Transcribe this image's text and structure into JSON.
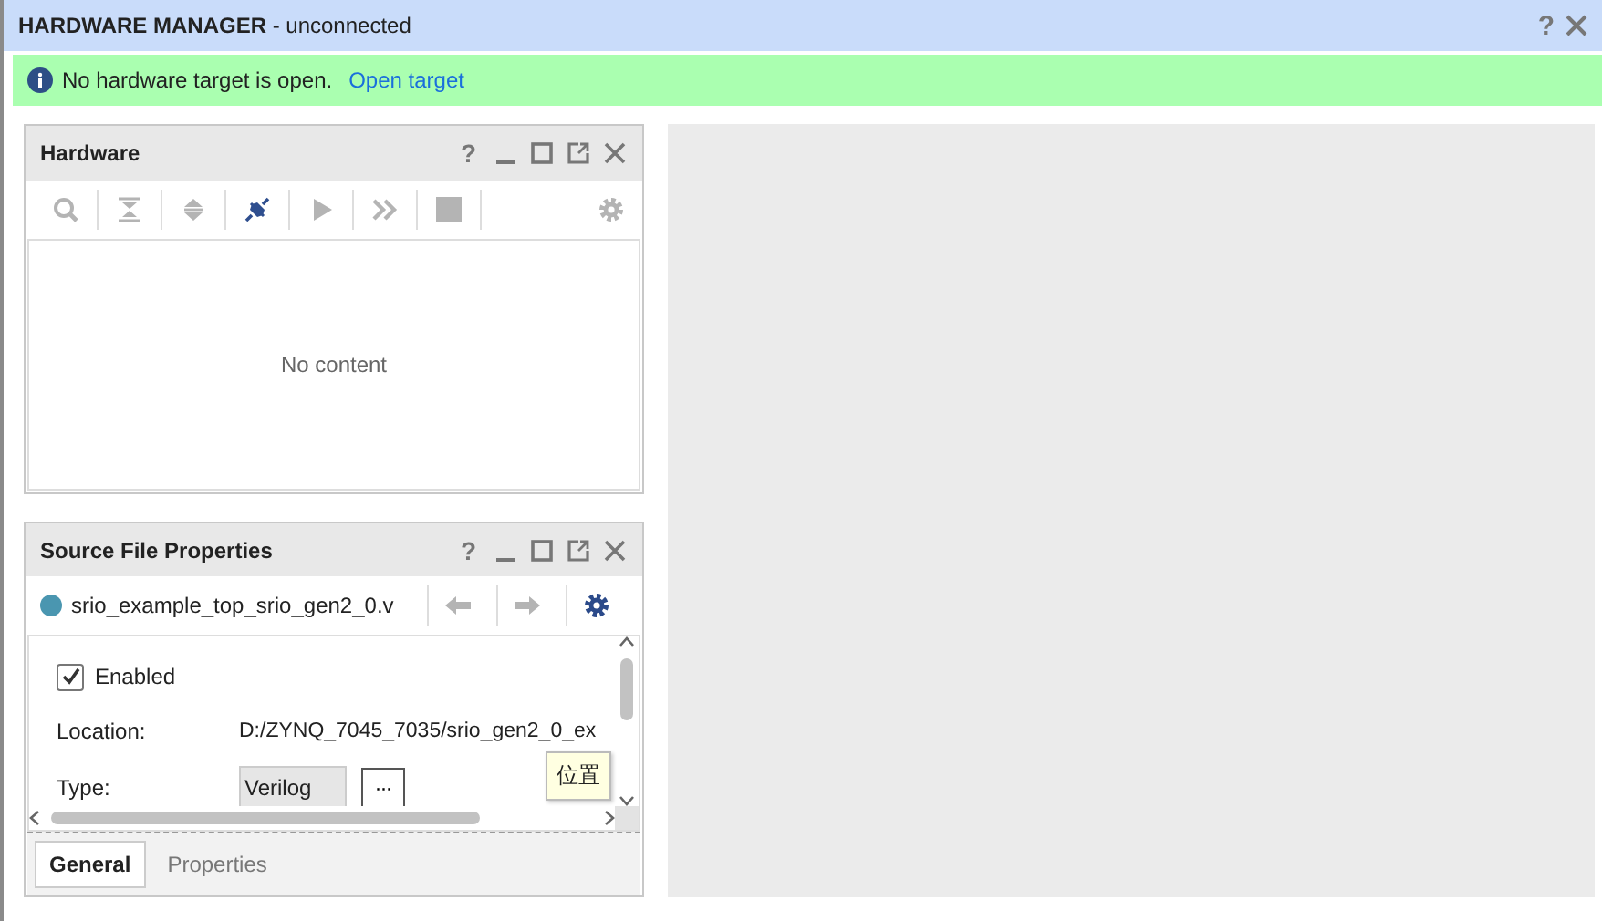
{
  "header": {
    "title": "HARDWARE MANAGER",
    "status": "- unconnected",
    "help": "?"
  },
  "banner": {
    "message": "No hardware target is open.",
    "link": "Open target"
  },
  "hardware_panel": {
    "title": "Hardware",
    "help": "?",
    "toolbar": [
      {
        "kind": "search",
        "disabled": true
      },
      {
        "kind": "collapse",
        "disabled": true
      },
      {
        "kind": "expand",
        "disabled": true
      },
      {
        "kind": "connect",
        "disabled": false
      },
      {
        "kind": "run",
        "disabled": true
      },
      {
        "kind": "step",
        "disabled": true
      },
      {
        "kind": "stop",
        "disabled": true
      },
      {
        "kind": "settings",
        "disabled": true
      }
    ],
    "empty_text": "No content"
  },
  "properties_panel": {
    "title": "Source File Properties",
    "help": "?",
    "file": {
      "name": "srio_example_top_srio_gen2_0.v",
      "color": "#4a96b0"
    },
    "nav": [
      {
        "kind": "back",
        "disabled": true
      },
      {
        "kind": "forward",
        "disabled": true
      },
      {
        "kind": "settings",
        "disabled": false
      }
    ],
    "enabled": {
      "label": "Enabled",
      "checked": true
    },
    "fields": [
      {
        "label": "Location:",
        "value": "D:/ZYNQ_7045_7035/srio_gen2_0_ex"
      },
      {
        "label": "Type:",
        "value": "Verilog",
        "button": "···"
      }
    ],
    "tooltip": "位置",
    "tabs": [
      {
        "label": "General",
        "selected": true
      },
      {
        "label": "Properties",
        "selected": false
      }
    ]
  }
}
